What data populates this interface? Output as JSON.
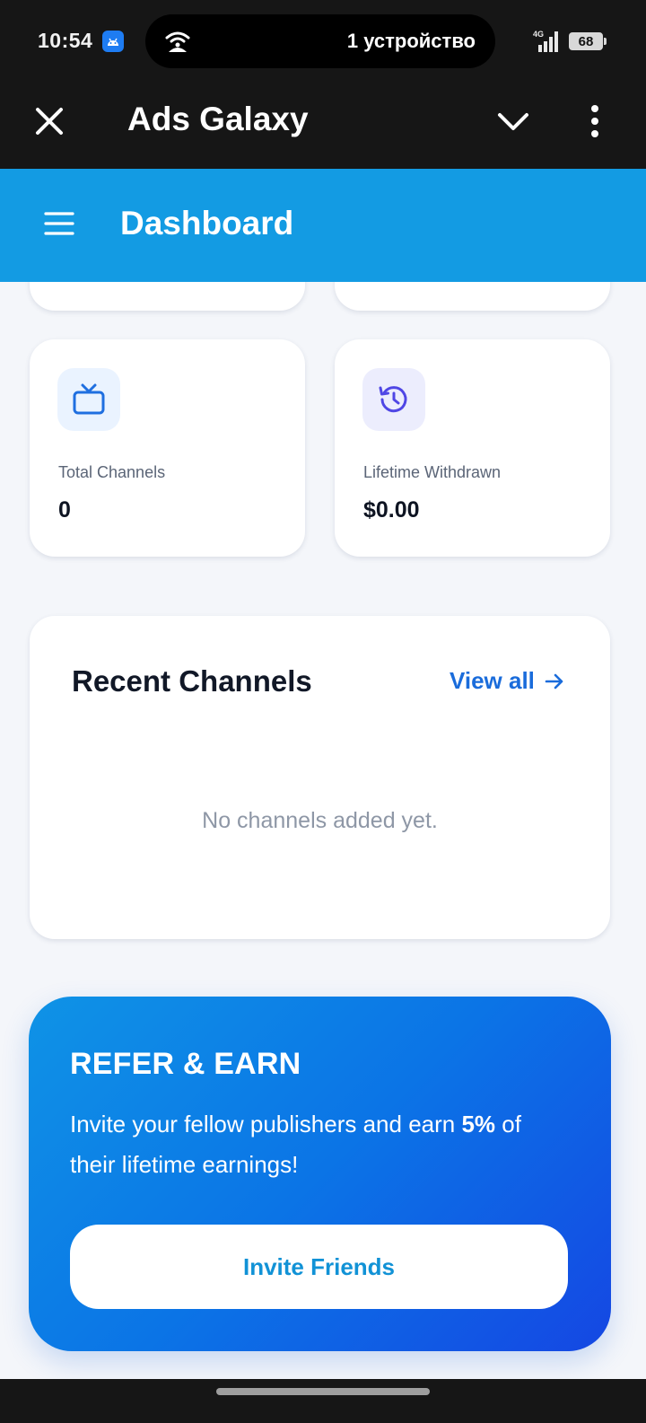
{
  "status_bar": {
    "time": "10:54",
    "notification_text": "1 устройство",
    "network": "4G",
    "battery": "68"
  },
  "appbar": {
    "title": "Ads Galaxy",
    "close_icon": "close-icon",
    "chevron_icon": "chevron-down-icon",
    "more_icon": "more-vertical-icon"
  },
  "dashboard": {
    "title": "Dashboard",
    "menu_icon": "hamburger-menu-icon"
  },
  "stats": [
    {
      "label": "Total Channels",
      "value": "0",
      "icon": "tv-icon",
      "accent": "#1f6fe0"
    },
    {
      "label": "Lifetime Withdrawn",
      "value": "$0.00",
      "icon": "history-icon",
      "accent": "#4f46e5"
    }
  ],
  "recent_channels": {
    "title": "Recent Channels",
    "view_all": "View all",
    "empty_message": "No channels added yet."
  },
  "refer": {
    "title": "REFER & EARN",
    "text_before": "Invite your fellow publishers and earn ",
    "highlight": "5%",
    "text_after": " of their lifetime earnings!",
    "button": "Invite Friends"
  },
  "colors": {
    "header_blue": "#139be3",
    "link_blue": "#1a6cdb",
    "refer_gradient_start": "#0f93e6",
    "refer_gradient_end": "#1547e3"
  }
}
